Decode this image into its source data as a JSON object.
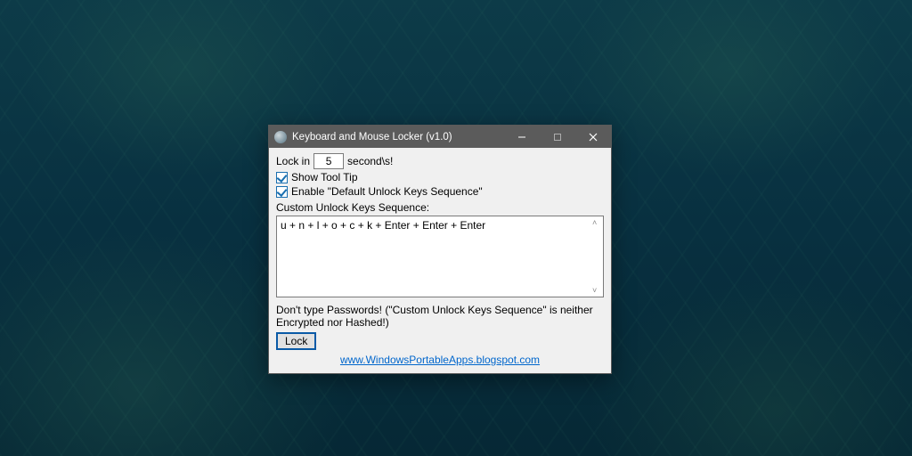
{
  "titlebar": {
    "title": "Keyboard and Mouse Locker (v1.0)"
  },
  "lock_row": {
    "prefix": "Lock in",
    "seconds_value": "5",
    "suffix": "second\\s!"
  },
  "checkboxes": {
    "show_tooltip": {
      "checked": true,
      "label": "Show Tool Tip"
    },
    "enable_default": {
      "checked": true,
      "label": "Enable \"Default Unlock Keys Sequence\""
    }
  },
  "custom_sequence": {
    "label": "Custom Unlock Keys Sequence:",
    "value": "u + n + l + o + c + k + Enter + Enter + Enter"
  },
  "warning_text": "Don't type Passwords! (\"Custom Unlock Keys Sequence\" is neither Encrypted nor Hashed!)",
  "lock_button_label": "Lock",
  "link_text": "www.WindowsPortableApps.blogspot.com"
}
